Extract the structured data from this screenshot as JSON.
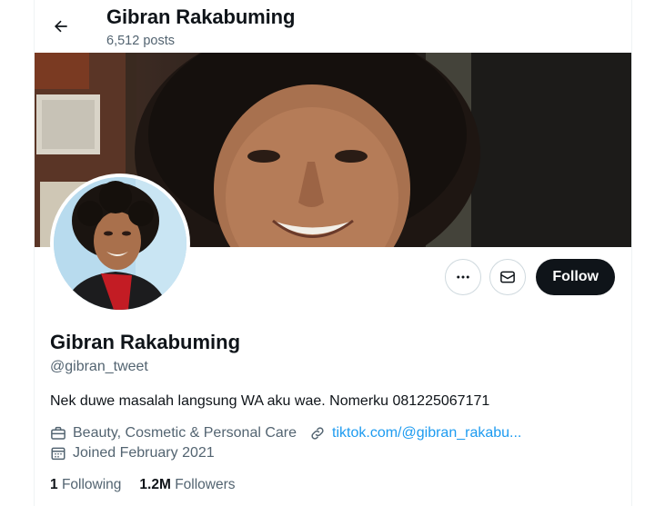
{
  "header": {
    "name": "Gibran Rakabuming",
    "posts_count": "6,512 posts"
  },
  "actions": {
    "more_icon": "more-horizontal-icon",
    "message_icon": "envelope-icon",
    "follow_label": "Follow"
  },
  "profile": {
    "name": "Gibran Rakabuming",
    "handle": "@gibran_tweet",
    "bio": "Nek duwe masalah langsung WA aku wae. Nomerku 081225067171",
    "category": "Beauty, Cosmetic & Personal Care",
    "website": "tiktok.com/@gibran_rakabu...",
    "joined": "Joined February 2021"
  },
  "stats": {
    "following_count": "1",
    "following_label": "Following",
    "followers_count": "1.2M",
    "followers_label": "Followers"
  },
  "colors": {
    "text": "#0f1419",
    "secondary": "#536471",
    "link": "#1d9bf0",
    "follow_button": "#0f1419"
  }
}
